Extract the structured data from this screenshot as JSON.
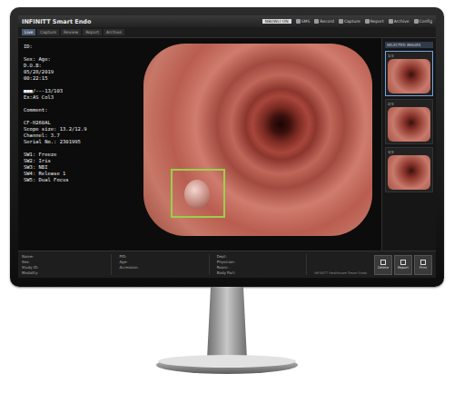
{
  "window": {
    "title": "INFINITT Smart Endo"
  },
  "tabs": [
    {
      "label": "Live",
      "selected": true
    },
    {
      "label": "Capture",
      "selected": false
    },
    {
      "label": "Review",
      "selected": false
    },
    {
      "label": "Report",
      "selected": false
    },
    {
      "label": "Archive",
      "selected": false
    }
  ],
  "toolbar": [
    {
      "label": "SMS"
    },
    {
      "label": "Record"
    },
    {
      "label": "Capture"
    },
    {
      "label": "Report"
    },
    {
      "label": "Archive"
    },
    {
      "label": "Config"
    }
  ],
  "toolbar_field": {
    "value": "NBI/WLI ON"
  },
  "patient": {
    "groups": [
      [
        "ID:",
        "",
        "Sex:  Age:",
        "D.O.B:",
        "05/28/2019",
        "00:22:15"
      ],
      [
        "■■■/---13/103",
        "Ex:AS Col3",
        "",
        "Comment:"
      ],
      [
        "CF-H260AL",
        "Scope size: 13.2/12.9",
        "Channel: 3.7",
        "Serial No.: 2301995"
      ],
      [
        "SW1: Freeze",
        "SW2: Iris",
        "SW3: NBI",
        "SW4: Release 1",
        "SW5: Dual Focus"
      ]
    ]
  },
  "thumbnails": {
    "header": "SELECTED IMAGES",
    "items": [
      {
        "label": "1/3",
        "selected": true
      },
      {
        "label": "2/3",
        "selected": false
      },
      {
        "label": "3/3",
        "selected": false
      }
    ]
  },
  "info_columns": [
    [
      "Name:",
      "Sex:",
      "Study ID:",
      "Modality:"
    ],
    [
      "PID:",
      "Age:",
      "Accession:"
    ],
    [
      "Dept:",
      "Physician:",
      "Room:",
      "Body Part:"
    ]
  ],
  "buttons": [
    {
      "label": "Delete"
    },
    {
      "label": "Report"
    },
    {
      "label": "Print"
    }
  ],
  "status": {
    "label": "INFINITT Healthcare Smart Endo"
  }
}
